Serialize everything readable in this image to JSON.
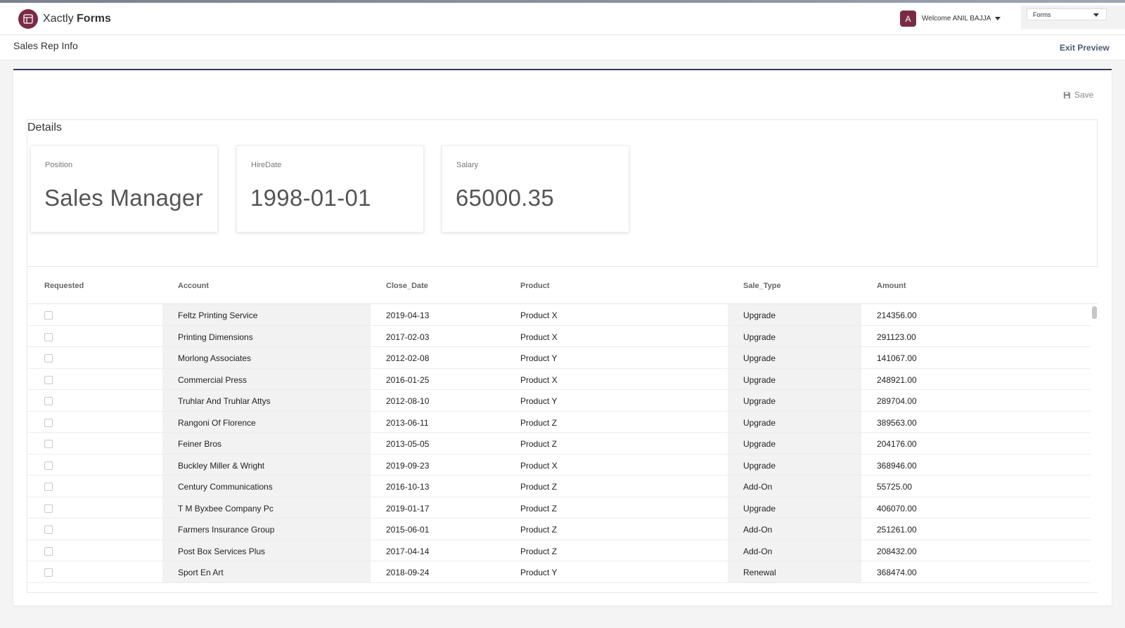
{
  "header": {
    "brand_light": "Xactly",
    "brand_bold": "Forms",
    "avatar_letter": "A",
    "welcome": "Welcome ANIL BAJJA",
    "forms_select": "Forms"
  },
  "subheader": {
    "title": "Sales Rep Info",
    "exit_label": "Exit Preview"
  },
  "toolbar": {
    "save_label": "Save"
  },
  "details": {
    "title": "Details",
    "cards": [
      {
        "label": "Position",
        "value": "Sales Manager"
      },
      {
        "label": "HireDate",
        "value": "1998-01-01"
      },
      {
        "label": "Salary",
        "value": "65000.35"
      }
    ]
  },
  "table": {
    "columns": [
      "Requested",
      "Account",
      "Close_Date",
      "Product",
      "Sale_Type",
      "Amount"
    ],
    "rows": [
      {
        "account": "Feltz Printing Service",
        "close_date": "2019-04-13",
        "product": "Product X",
        "sale_type": "Upgrade",
        "amount": "214356.00"
      },
      {
        "account": "Printing Dimensions",
        "close_date": "2017-02-03",
        "product": "Product X",
        "sale_type": "Upgrade",
        "amount": "291123.00"
      },
      {
        "account": "Morlong Associates",
        "close_date": "2012-02-08",
        "product": "Product Y",
        "sale_type": "Upgrade",
        "amount": "141067.00"
      },
      {
        "account": "Commercial Press",
        "close_date": "2016-01-25",
        "product": "Product X",
        "sale_type": "Upgrade",
        "amount": "248921.00"
      },
      {
        "account": "Truhlar And Truhlar Attys",
        "close_date": "2012-08-10",
        "product": "Product Y",
        "sale_type": "Upgrade",
        "amount": "289704.00"
      },
      {
        "account": "Rangoni Of Florence",
        "close_date": "2013-06-11",
        "product": "Product Z",
        "sale_type": "Upgrade",
        "amount": "389563.00"
      },
      {
        "account": "Feiner Bros",
        "close_date": "2013-05-05",
        "product": "Product Z",
        "sale_type": "Upgrade",
        "amount": "204176.00"
      },
      {
        "account": "Buckley Miller & Wright",
        "close_date": "2019-09-23",
        "product": "Product X",
        "sale_type": "Upgrade",
        "amount": "368946.00"
      },
      {
        "account": "Century Communications",
        "close_date": "2016-10-13",
        "product": "Product Z",
        "sale_type": "Add-On",
        "amount": "55725.00"
      },
      {
        "account": "T M Byxbee Company Pc",
        "close_date": "2019-01-17",
        "product": "Product Z",
        "sale_type": "Upgrade",
        "amount": "406070.00"
      },
      {
        "account": "Farmers Insurance Group",
        "close_date": "2015-06-01",
        "product": "Product Z",
        "sale_type": "Add-On",
        "amount": "251261.00"
      },
      {
        "account": "Post Box Services Plus",
        "close_date": "2017-04-14",
        "product": "Product Z",
        "sale_type": "Add-On",
        "amount": "208432.00"
      },
      {
        "account": "Sport En Art",
        "close_date": "2018-09-24",
        "product": "Product Y",
        "sale_type": "Renewal",
        "amount": "368474.00"
      }
    ]
  },
  "colors": {
    "brand": "#7a2a46",
    "panel_accent": "#2e3e5a",
    "exit_link": "#4a5a7a"
  },
  "icons": {
    "logo": "forms-logo-icon",
    "save": "floppy-disk-icon",
    "dropdown": "chevron-down-icon"
  }
}
